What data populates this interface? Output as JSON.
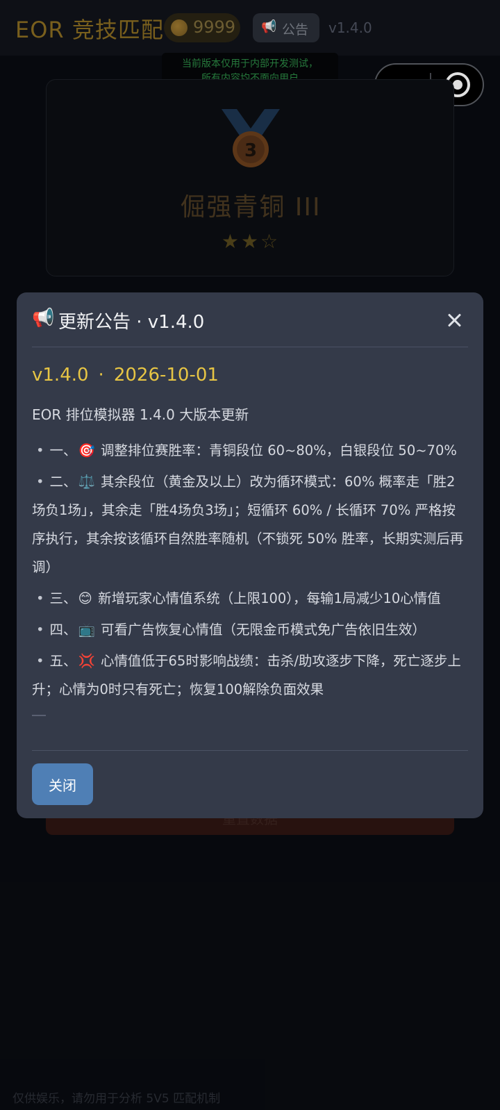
{
  "header": {
    "app_title": "EOR 竞技匹配",
    "coins": "9999",
    "notice_label": "公告",
    "version": "v1.4.0"
  },
  "dev_tip": {
    "line1": "当前版本仅用于内部开发测试，",
    "line2": "所有内容均不面向用户"
  },
  "rank": {
    "medal_number": "3",
    "name": "倔强青铜 III",
    "stars_text": "★★☆",
    "stars_filled": 2,
    "stars_total": 3
  },
  "reset_label": "重置数据",
  "footer_note": "仅供娱乐，请勿用于分析 5V5 匹配机制",
  "modal": {
    "icon": "📢",
    "title": "更新公告 · v1.4.0",
    "version": "v1.4.0",
    "separator": "·",
    "date": "2026-10-01",
    "summary": "EOR 排位模拟器 1.4.0 大版本更新",
    "items": [
      {
        "bullet": "•",
        "prefix": "一、",
        "emoji": "🎯",
        "text": "调整排位赛胜率：青铜段位 60~80%，白银段位 50~70%"
      },
      {
        "bullet": "•",
        "prefix": "二、",
        "emoji": "⚖️",
        "text": "其余段位（黄金及以上）改为循环模式：60% 概率走「胜2场负1场」，其余走「胜4场负3场」；短循环 60% / 长循环 70% 严格按序执行，其余按该循环自然胜率随机（不锁死 50% 胜率，长期实测后再调）"
      },
      {
        "bullet": "•",
        "prefix": "三、",
        "emoji": "😊",
        "text": "新增玩家心情值系统（上限100），每输1局减少10心情值"
      },
      {
        "bullet": "•",
        "prefix": "四、",
        "emoji": "📺",
        "text": "可看广告恢复心情值（无限金币模式免广告依旧生效）"
      },
      {
        "bullet": "•",
        "prefix": "五、",
        "emoji": "💢",
        "text": "心情值低于65时影响战绩：击杀/助攻逐步下降，死亡逐步上升；心情为0时只有死亡；恢复100解除负面效果"
      }
    ],
    "ok_label": "关闭"
  },
  "colors": {
    "background": "#090b10",
    "modal_bg": "#343a49",
    "accent_gold": "#e7c544",
    "button_blue": "#4f7fb5",
    "danger_red": "#2e1512"
  }
}
